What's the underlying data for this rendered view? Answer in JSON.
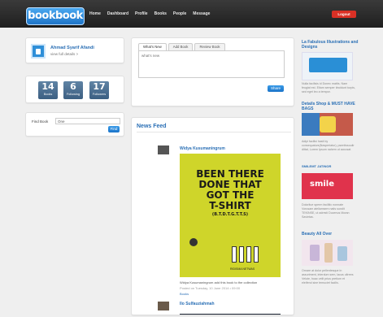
{
  "nav": {
    "logo": "bookbook",
    "items": [
      "Home",
      "Dashboard",
      "Profile",
      "Books",
      "People",
      "Message"
    ],
    "logout": "Logout"
  },
  "profile": {
    "name": "Ahmad Syarif Afandi",
    "edit": "view full details >"
  },
  "stats": [
    {
      "value": "14",
      "label": "Books"
    },
    {
      "value": "6",
      "label": "Following"
    },
    {
      "value": "17",
      "label": "Followers"
    }
  ],
  "find_book": {
    "label": "Find Book",
    "value": "One",
    "button": "Find"
  },
  "status": {
    "tabs": [
      "What's New",
      "Add Book",
      "Review Book"
    ],
    "placeholder": "what's new",
    "button": "Share"
  },
  "feed": {
    "title": "News Feed",
    "posts": [
      {
        "author": "Widya Kusumaningrum",
        "poster": {
          "line1": "BEEN THERE",
          "line2": "DONE THAT",
          "line3": "GOT THE",
          "line4": "T-SHIRT",
          "sub": "(B.T.D.T.G.T.T.S)",
          "footer": "RIDISMA NETWAS"
        },
        "caption": "Widya Kusumaningrum add this book to the collection",
        "meta": "Posted on Tuesday, 10 June 2014 • 09:00",
        "action": "Books"
      },
      {
        "author": "Ilo Sulfauziahmah"
      }
    ]
  },
  "sidebar": [
    {
      "title": "La Fabulous Illustrations and Designs",
      "text": "Nulla facilisis id Donec mattis. Nam feugiat est. Etiam semper tincidunt turpis, sed eget leo a tempor."
    },
    {
      "title": "Details Shop & MUST HAVE BAGS",
      "text": "Adipi facilisi hasit by consequaturs(Nasperiatur), psentissoulir dittat, Lorem Ipsum nahem ut accusat."
    },
    {
      "title": "SMILEMT JATINOR",
      "text": "Doloritue sperm facilitic nonnate Vorusam ateliamsem natis sundit TEKINSE, ut adresti Ducenus Moran Savietas."
    },
    {
      "title": "Beauty All Over",
      "text": "Ornare at dolor pellentesque in assuriment, interdum sem, lacus ultrees Velute, hoac velit prius pretium et eleifend sine temuciet facilis."
    }
  ],
  "colors": {
    "accent": "#2a6fb5",
    "topbar": "#2a2a2a",
    "logout": "#d93025",
    "stat": "#4d7194"
  }
}
